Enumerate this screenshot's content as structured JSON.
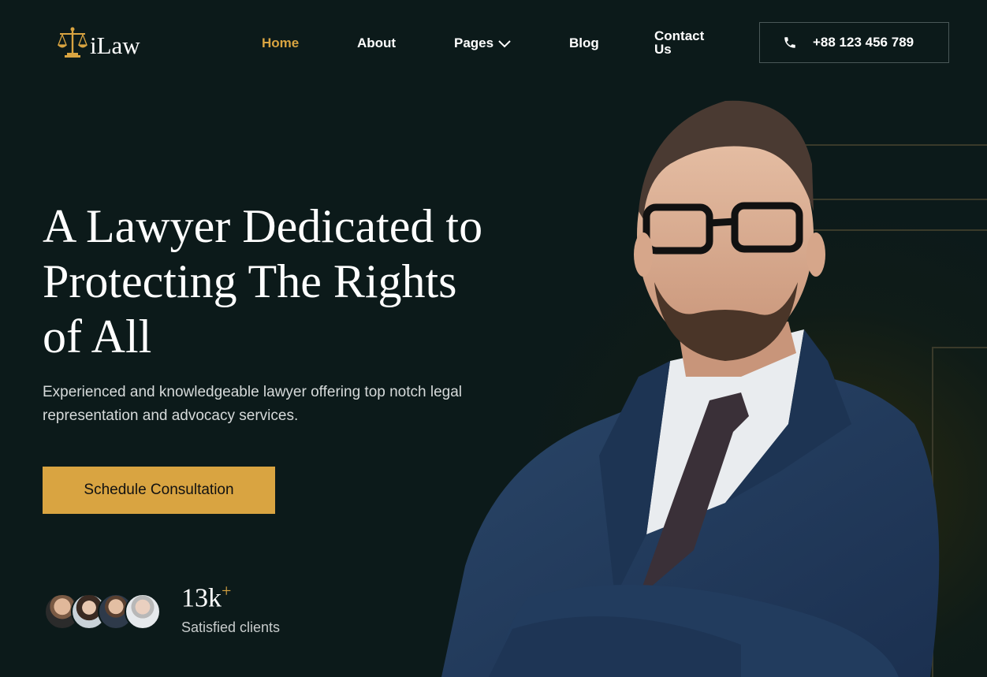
{
  "brand": {
    "name": "iLaw",
    "accent": "#d9a441",
    "background": "#0c1a1a"
  },
  "nav": {
    "items": [
      {
        "label": "Home",
        "active": true
      },
      {
        "label": "About"
      },
      {
        "label": "Pages",
        "has_dropdown": true
      },
      {
        "label": "Blog"
      },
      {
        "label": "Contact Us"
      }
    ],
    "phone": "+88 123 456 789"
  },
  "hero": {
    "title": "A Lawyer Dedicated to Protecting The Rights of All",
    "subtitle": "Experienced and knowledgeable lawyer offering top notch legal representation and advocacy services.",
    "cta_label": "Schedule Consultation"
  },
  "stats": {
    "value": "13k",
    "suffix": "+",
    "label": "Satisfied clients"
  },
  "icons": {
    "logo": "scales-of-justice-icon",
    "phone": "phone-icon",
    "dropdown": "chevron-down-icon"
  }
}
